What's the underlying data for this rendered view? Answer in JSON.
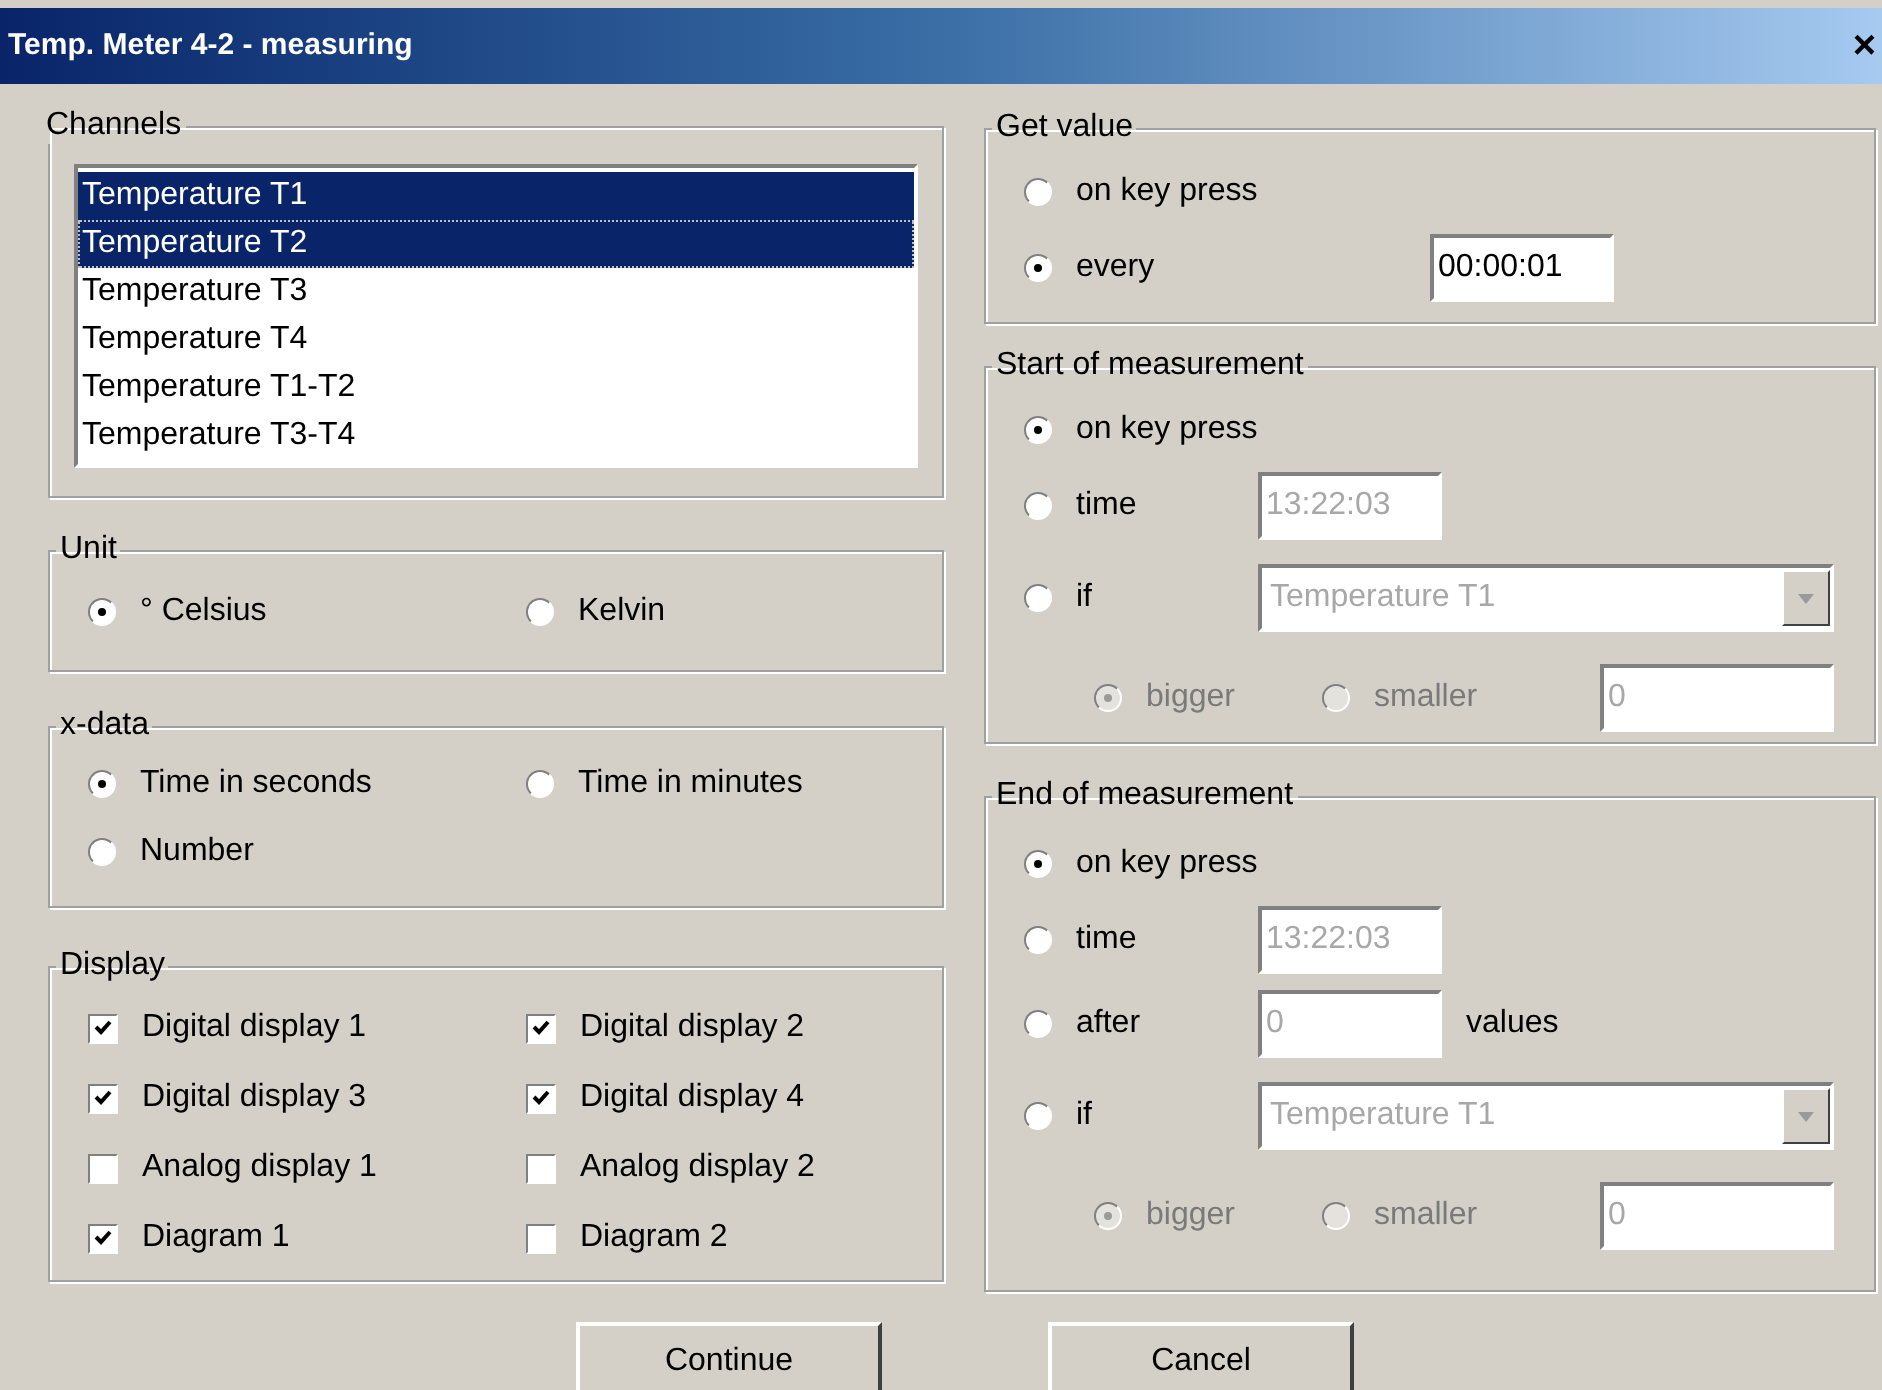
{
  "window": {
    "title": "Temp. Meter 4-2 - measuring",
    "close": "×"
  },
  "channels": {
    "title": "Channels",
    "items": [
      {
        "label": "Temperature T1",
        "selected": true,
        "focused": false
      },
      {
        "label": "Temperature T2",
        "selected": true,
        "focused": true
      },
      {
        "label": "Temperature T3",
        "selected": false,
        "focused": false
      },
      {
        "label": "Temperature T4",
        "selected": false,
        "focused": false
      },
      {
        "label": "Temperature T1-T2",
        "selected": false,
        "focused": false
      },
      {
        "label": "Temperature T3-T4",
        "selected": false,
        "focused": false
      }
    ]
  },
  "unit": {
    "title": "Unit",
    "options": [
      {
        "label": "° Celsius",
        "selected": true
      },
      {
        "label": "Kelvin",
        "selected": false
      }
    ]
  },
  "x_data": {
    "title": "x-data",
    "options": [
      {
        "label": "Time in seconds",
        "selected": true
      },
      {
        "label": "Time in minutes",
        "selected": false
      },
      {
        "label": "Number",
        "selected": false
      }
    ]
  },
  "display": {
    "title": "Display",
    "items": [
      {
        "label": "Digital display 1",
        "checked": true
      },
      {
        "label": "Digital display 2",
        "checked": true
      },
      {
        "label": "Digital display 3",
        "checked": true
      },
      {
        "label": "Digital display 4",
        "checked": true
      },
      {
        "label": "Analog display 1",
        "checked": false
      },
      {
        "label": "Analog display 2",
        "checked": false
      },
      {
        "label": "Diagram 1",
        "checked": true
      },
      {
        "label": "Diagram 2",
        "checked": false
      }
    ]
  },
  "get_value": {
    "title": "Get value",
    "options": [
      {
        "kind": "plain",
        "label": "on key press",
        "selected": false
      },
      {
        "kind": "field",
        "label": "every",
        "selected": true,
        "value": "00:00:01",
        "disabled": false
      }
    ]
  },
  "start": {
    "title": "Start of measurement",
    "options": [
      {
        "kind": "plain",
        "label": "on key press",
        "selected": true
      },
      {
        "kind": "field",
        "label": "time",
        "selected": false,
        "value": "13:22:03",
        "disabled": true
      },
      {
        "kind": "select",
        "label": "if",
        "selected": false,
        "value": "Temperature T1",
        "disabled": true
      }
    ],
    "comparison": {
      "disabled": true,
      "value": "0",
      "options": [
        {
          "label": "bigger",
          "selected": true
        },
        {
          "label": "smaller",
          "selected": false
        }
      ]
    }
  },
  "end": {
    "title": "End of measurement",
    "options": [
      {
        "kind": "plain",
        "label": "on key press",
        "selected": true
      },
      {
        "kind": "field",
        "label": "time",
        "selected": false,
        "value": "13:22:03",
        "disabled": true
      },
      {
        "kind": "field",
        "label": "after",
        "selected": false,
        "value": "0",
        "disabled": true,
        "suffix": "values"
      },
      {
        "kind": "select",
        "label": "if",
        "selected": false,
        "value": "Temperature T1",
        "disabled": true
      }
    ],
    "comparison": {
      "disabled": true,
      "value": "0",
      "options": [
        {
          "label": "bigger",
          "selected": true
        },
        {
          "label": "smaller",
          "selected": false
        }
      ]
    }
  },
  "buttons": [
    "Continue",
    "Cancel"
  ]
}
